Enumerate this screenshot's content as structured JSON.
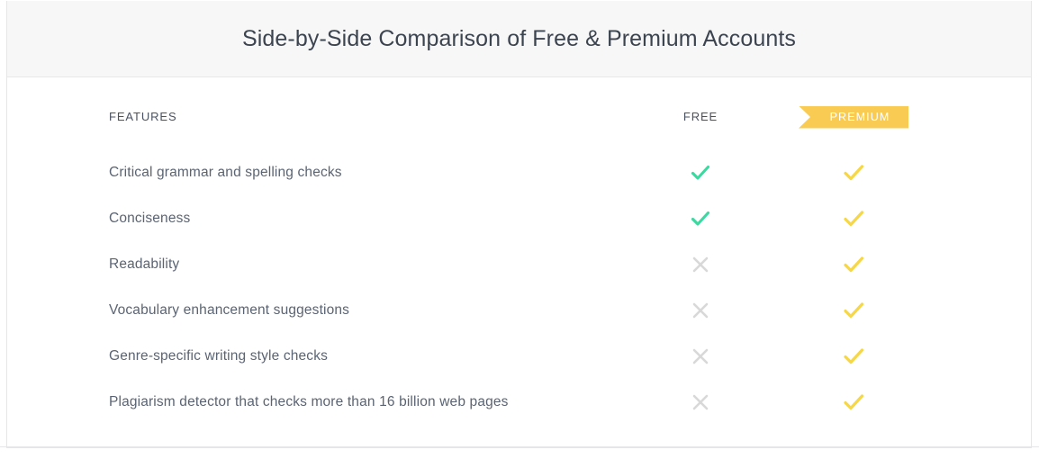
{
  "header": {
    "title": "Side-by-Side Comparison of Free & Premium Accounts"
  },
  "table": {
    "columns": {
      "features_label": "FEATURES",
      "free_label": "FREE",
      "premium_label": "PREMIUM"
    },
    "rows": [
      {
        "feature": "Critical grammar and spelling checks",
        "free": "check",
        "premium": "check"
      },
      {
        "feature": "Conciseness",
        "free": "check",
        "premium": "check"
      },
      {
        "feature": "Readability",
        "free": "cross",
        "premium": "check"
      },
      {
        "feature": "Vocabulary enhancement suggestions",
        "free": "cross",
        "premium": "check"
      },
      {
        "feature": "Genre-specific writing style checks",
        "free": "cross",
        "premium": "check"
      },
      {
        "feature": "Plagiarism detector that checks more than 16 billion web pages",
        "free": "cross",
        "premium": "check"
      }
    ]
  },
  "icons": {
    "check_free": "check-icon",
    "check_premium": "check-icon",
    "cross": "cross-icon"
  },
  "colors": {
    "header_background": "#f7f7f8",
    "card_border": "#e6e6e8",
    "title_text": "#3c4450",
    "feature_text": "#5b6473",
    "check_free": "#3ad9a0",
    "check_premium": "#f6d747",
    "cross": "#d8d8d8",
    "premium_badge": "#f9cb52",
    "premium_badge_text": "#ffffff"
  }
}
